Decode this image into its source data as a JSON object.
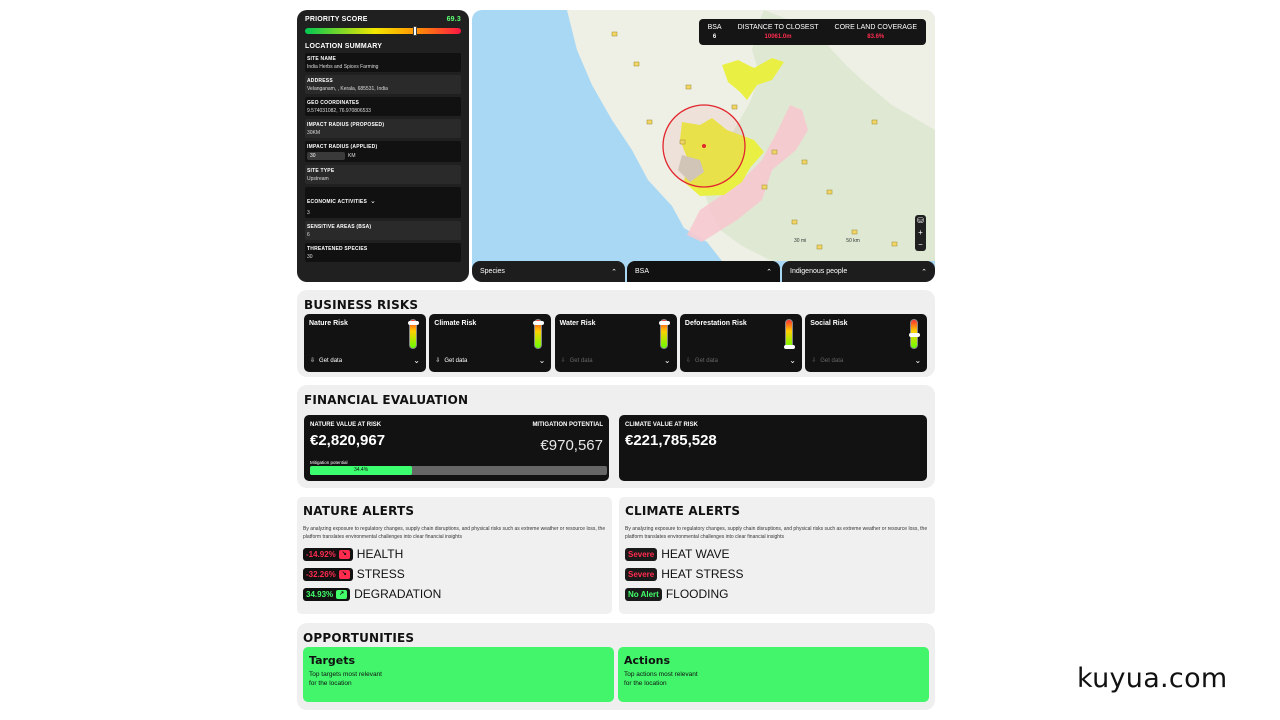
{
  "priority": {
    "label": "PRIORITY SCORE",
    "score": "69.3",
    "marker_fraction": 0.693
  },
  "location_summary": {
    "title": "LOCATION SUMMARY",
    "fields": [
      {
        "label": "SITE NAME",
        "value": "India Herbs and Spices Farming"
      },
      {
        "label": "ADDRESS",
        "value": "Velanganam, , Kerala, 685531, India"
      },
      {
        "label": "GEO COORDINATES",
        "value": "9.574031082, 76.970806533"
      },
      {
        "label": "IMPACT RADIUS (PROPOSED)",
        "value": "30KM"
      },
      {
        "label": "IMPACT RADIUS (APPLIED)",
        "value": "30",
        "unit": "KM"
      },
      {
        "label": "SITE TYPE",
        "value": "Upstream"
      },
      {
        "label": "ECONOMIC ACTIVITIES",
        "value": "3"
      },
      {
        "label": "SENSITIVE AREAS (BSA)",
        "value": "6"
      },
      {
        "label": "THREATENED SPECIES",
        "value": "30"
      }
    ]
  },
  "map": {
    "legend": [
      {
        "label": "BSA",
        "value": "6"
      },
      {
        "label": "DISTANCE TO CLOSEST",
        "value": "10061.0m"
      },
      {
        "label": "CORE LAND COVERAGE",
        "value": "83.6%"
      }
    ],
    "tabs": [
      "Species",
      "BSA",
      "Indigenous people"
    ],
    "active_tab": "BSA",
    "scale": [
      "30 mi",
      "50 km"
    ],
    "controls": [
      "⛁",
      "+",
      "−"
    ]
  },
  "business_risks": {
    "title": "BUSINESS RISKS",
    "cards": [
      {
        "title": "Nature Risk",
        "action": "Get data",
        "level": 0.95,
        "active": true
      },
      {
        "title": "Climate Risk",
        "action": "Get data",
        "level": 0.95,
        "active": true
      },
      {
        "title": "Water Risk",
        "action": "Get data",
        "level": 0.95,
        "active": false
      },
      {
        "title": "Deforestation Risk",
        "action": "Get data",
        "level": 0.05,
        "active": false
      },
      {
        "title": "Social Risk",
        "action": "Get data",
        "level": 0.5,
        "active": false
      }
    ]
  },
  "financial": {
    "title": "FINANCIAL EVALUATION",
    "nature_label": "NATURE VALUE AT RISK",
    "nature_value": "€2,820,967",
    "mitigation_label": "MITIGATION POTENTIAL",
    "mitigation_value": "€970,567",
    "mitigation_bar_label": "Mitigation potential",
    "mitigation_pct_text": "34.4%",
    "mitigation_fraction": 0.344,
    "climate_label": "CLIMATE VALUE AT RISK",
    "climate_value": "€221,785,528"
  },
  "nature_alerts": {
    "title": "NATURE ALERTS",
    "desc": "By analyzing exposure to regulatory changes, supply chain disruptions, and physical risks such as extreme weather or resource loss, the platform translates environmental challenges into clear financial insights",
    "items": [
      {
        "badge": "-14.92%",
        "label": "HEALTH",
        "trend": "down"
      },
      {
        "badge": "-32.26%",
        "label": "STRESS",
        "trend": "down"
      },
      {
        "badge": "34.93%",
        "label": "DEGRADATION",
        "trend": "up"
      }
    ]
  },
  "climate_alerts": {
    "title": "CLIMATE ALERTS",
    "desc": "By analyzing exposure to regulatory changes, supply chain disruptions, and physical risks such as extreme weather or resource loss, the platform translates environmental challenges into clear financial insights",
    "items": [
      {
        "badge": "Severe",
        "label": "HEAT WAVE",
        "level": "severe"
      },
      {
        "badge": "Severe",
        "label": "HEAT STRESS",
        "level": "severe"
      },
      {
        "badge": "No Alert",
        "label": "FLOODING",
        "level": "none"
      }
    ]
  },
  "opportunities": {
    "title": "OPPORTUNITIES",
    "cards": [
      {
        "title": "Targets",
        "desc": "Top targets most relevant for the location"
      },
      {
        "title": "Actions",
        "desc": "Top actions most relevant for the location"
      }
    ]
  },
  "brand": "kuyua.com"
}
